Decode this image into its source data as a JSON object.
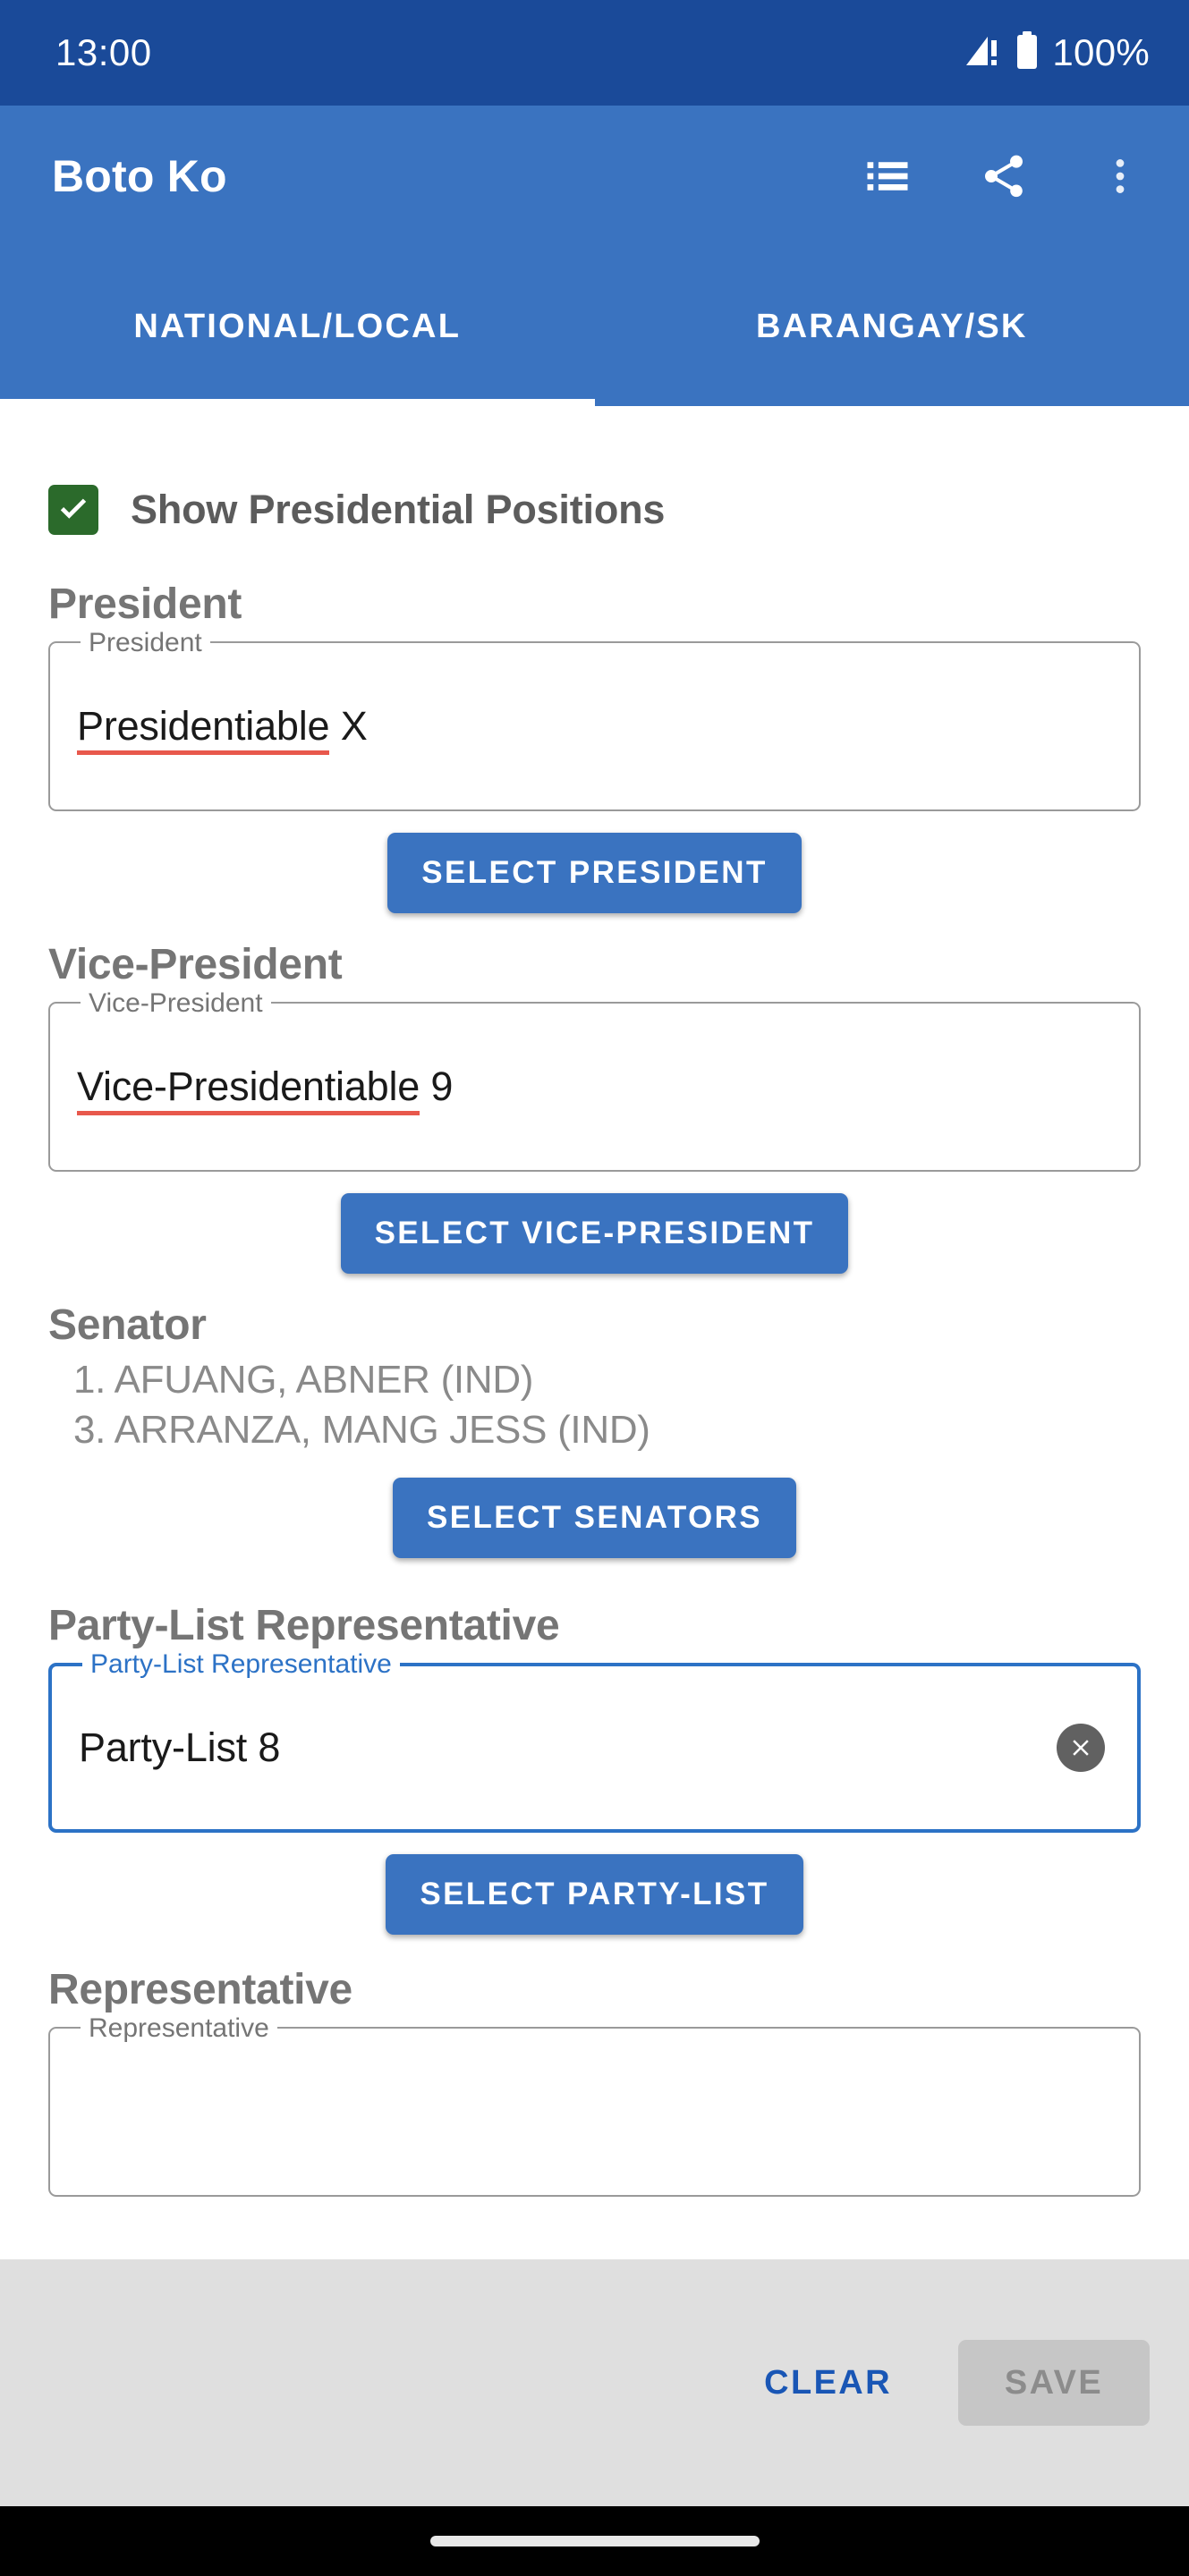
{
  "status_bar": {
    "time": "13:00",
    "battery_percent": "100%",
    "signal_icon": "signal-warning-icon",
    "battery_icon": "battery-full-icon"
  },
  "app_bar": {
    "title": "Boto Ko",
    "actions": [
      {
        "name": "view-list-icon",
        "label": "List"
      },
      {
        "name": "share-icon",
        "label": "Share"
      },
      {
        "name": "overflow-menu-icon",
        "label": "More options"
      }
    ]
  },
  "tabs": [
    {
      "label": "NATIONAL/LOCAL",
      "active": true
    },
    {
      "label": "BARANGAY/SK",
      "active": false
    }
  ],
  "checkbox": {
    "label": "Show Presidential Positions",
    "checked": true
  },
  "sections": {
    "president": {
      "heading": "President",
      "field_label": "President",
      "value_spelled": "Presidentiable",
      "value_rest": " X",
      "button_label": "SELECT PRESIDENT"
    },
    "vice_president": {
      "heading": "Vice-President",
      "field_label": "Vice-President",
      "value_spelled": "Vice-Presidentiable",
      "value_rest": " 9",
      "button_label": "SELECT VICE-PRESIDENT"
    },
    "senator": {
      "heading": "Senator",
      "selected": [
        "1. AFUANG, ABNER (IND)",
        "3. ARRANZA, MANG JESS (IND)"
      ],
      "button_label": "SELECT SENATORS"
    },
    "party_list": {
      "heading": "Party-List Representative",
      "field_label": "Party-List Representative",
      "value": "Party-List 8",
      "clear_icon": "clear-circle-icon",
      "button_label": "SELECT PARTY-LIST",
      "focused": true
    },
    "representative": {
      "heading": "Representative",
      "field_label": "Representative"
    }
  },
  "bottom_bar": {
    "clear_label": "CLEAR",
    "save_label": "SAVE",
    "save_enabled": false
  },
  "colors": {
    "status_bar": "#1A4A99",
    "app_bar": "#3A73C0",
    "accent": "#3A73C0",
    "checkbox_green": "#2B6A2B",
    "spellcheck_red": "#E8584C",
    "focused_blue": "#2C72C6",
    "clear_link_blue": "#1956B5",
    "bottom_bar_bg": "#DFDFDF",
    "section_heading": "#757575"
  }
}
